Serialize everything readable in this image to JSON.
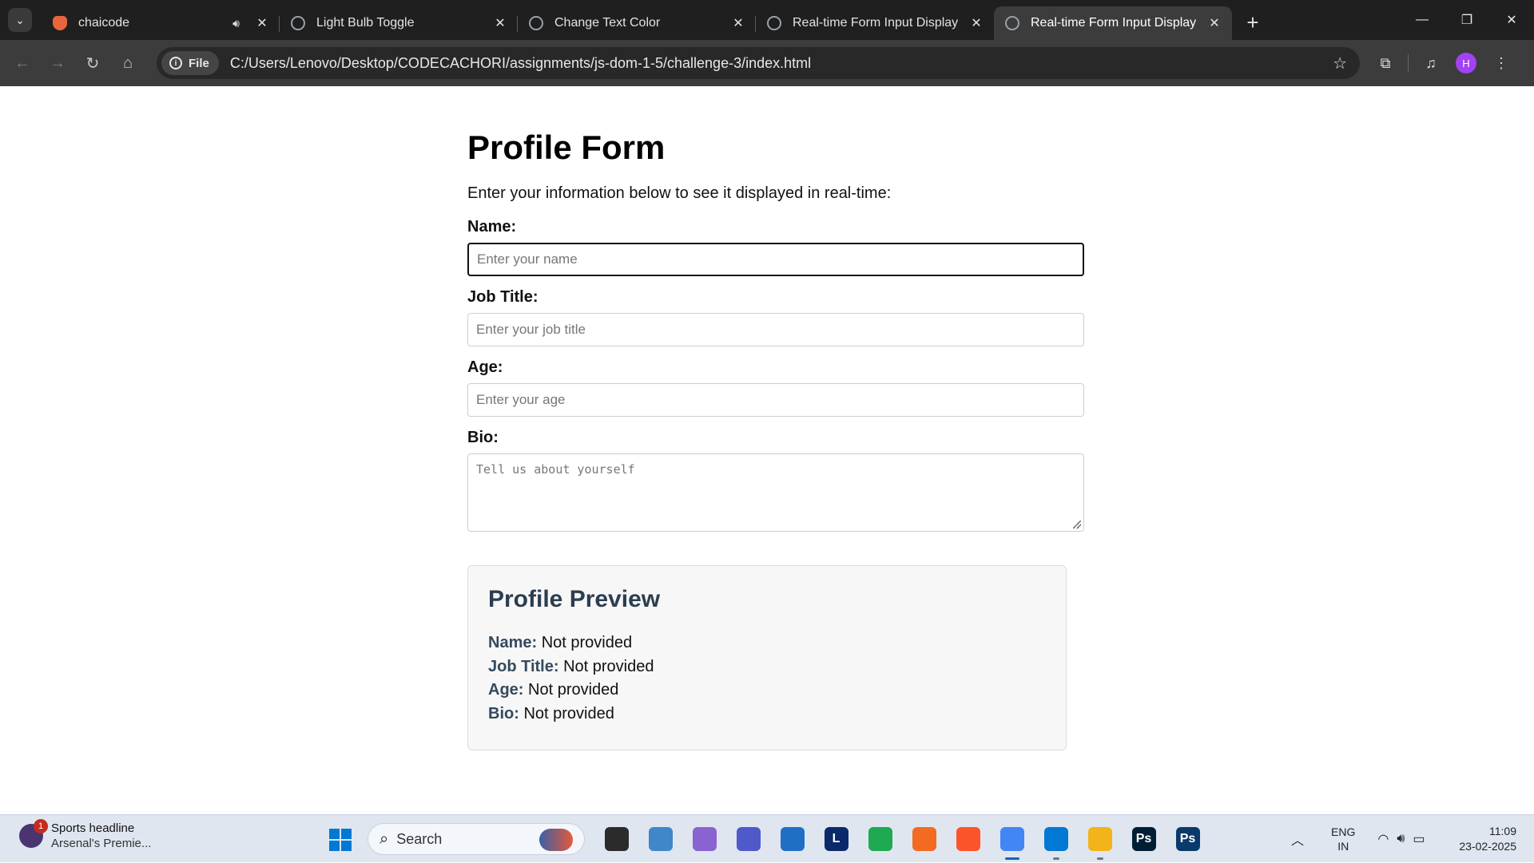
{
  "browser": {
    "tabs": [
      {
        "title": "chaicode",
        "icon": "chaicode-favicon-icon",
        "audio": true,
        "active": false
      },
      {
        "title": "Light Bulb Toggle",
        "icon": "globe-icon",
        "active": false
      },
      {
        "title": "Change Text Color",
        "icon": "globe-icon",
        "active": false
      },
      {
        "title": "Real-time Form Input Display",
        "icon": "globe-icon",
        "active": false
      },
      {
        "title": "Real-time Form Input Display",
        "icon": "globe-icon",
        "active": true
      }
    ],
    "site_chip": "File",
    "url": "C:/Users/Lenovo/Desktop/CODECACHORI/assignments/js-dom-1-5/challenge-3/index.html",
    "profile_initial": "H"
  },
  "page": {
    "title": "Profile Form",
    "intro": "Enter your information below to see it displayed in real-time:",
    "fields": {
      "name": {
        "label": "Name:",
        "placeholder": "Enter your name",
        "value": ""
      },
      "job": {
        "label": "Job Title:",
        "placeholder": "Enter your job title",
        "value": ""
      },
      "age": {
        "label": "Age:",
        "placeholder": "Enter your age",
        "value": ""
      },
      "bio": {
        "label": "Bio:",
        "placeholder": "Tell us about yourself",
        "value": ""
      }
    },
    "preview": {
      "title": "Profile Preview",
      "rows": [
        {
          "key": "Name:",
          "value": "Not provided"
        },
        {
          "key": "Job Title:",
          "value": "Not provided"
        },
        {
          "key": "Age:",
          "value": "Not provided"
        },
        {
          "key": "Bio:",
          "value": "Not provided"
        }
      ]
    }
  },
  "taskbar": {
    "news": {
      "headline": "Sports headline",
      "subtext": "Arsenal's Premie...",
      "badge": "1"
    },
    "search_label": "Search",
    "apps": [
      {
        "name": "file-explorer-icon",
        "label": "",
        "color": "#2b2b2b"
      },
      {
        "name": "control-panel-icon",
        "label": "",
        "color": "#3f87c9"
      },
      {
        "name": "copilot-icon",
        "label": "",
        "color": "#8a63d2"
      },
      {
        "name": "teams-icon",
        "label": "",
        "color": "#5059c9"
      },
      {
        "name": "microsoft-store-icon",
        "label": "",
        "color": "#1f6fc5"
      },
      {
        "name": "l-app-icon",
        "label": "L",
        "color": "#0b2a6b"
      },
      {
        "name": "whatsapp-icon",
        "label": "",
        "color": "#1ea952"
      },
      {
        "name": "pen-app-icon",
        "label": "",
        "color": "#f26b21"
      },
      {
        "name": "brave-icon",
        "label": "",
        "color": "#fb542b"
      },
      {
        "name": "chrome-icon",
        "label": "",
        "color": "#4285f4"
      },
      {
        "name": "vscode-icon",
        "label": "",
        "color": "#0078d4"
      },
      {
        "name": "folder-icon",
        "label": "",
        "color": "#f3b31a"
      },
      {
        "name": "photoshop-icon",
        "label": "Ps",
        "color": "#001e36"
      },
      {
        "name": "photoshop-icon-2",
        "label": "Ps",
        "color": "#0a3a6b"
      }
    ],
    "lang": {
      "line1": "ENG",
      "line2": "IN"
    },
    "time": "11:09",
    "date": "23-02-2025"
  }
}
